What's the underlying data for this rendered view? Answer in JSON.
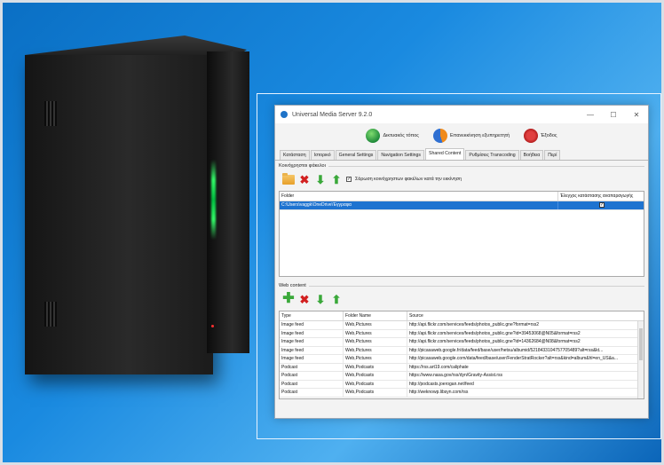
{
  "window": {
    "title": "Universal Media Server 9.2.0",
    "minimize": "—",
    "maximize": "☐",
    "close": "✕"
  },
  "toolbar": {
    "website_label": "Δικτυακός τόπος",
    "restart_label": "Επανεκκίνηση εξυπηρετητή",
    "exit_label": "Έξοδος"
  },
  "tabs": [
    {
      "label": "Κατάσταση"
    },
    {
      "label": "Ιστορικό"
    },
    {
      "label": "General Settings"
    },
    {
      "label": "Navigation Settings"
    },
    {
      "label": "Shared Content"
    },
    {
      "label": "Ρυθμίσεις Transcoding"
    },
    {
      "label": "Βοήθεια"
    },
    {
      "label": "Περί"
    }
  ],
  "shared_folders": {
    "section_title": "Κοινόχρηστοι φάκελοι",
    "scan_checkbox_label": "Σάρωση κοινόχρηστων φακέλων κατά την εκκίνηση",
    "scan_checked": "✓",
    "columns": {
      "folder": "Folder",
      "monitor": "Έλεγχος κατάστασης αναπαραγωγής"
    },
    "rows": [
      {
        "folder": "C:\\Users\\vaggk\\OneDrive\\Έγγραφα",
        "monitor": "✓"
      }
    ]
  },
  "web_content": {
    "section_title": "Web content",
    "columns": {
      "type": "Type",
      "folder_name": "Folder Name",
      "source": "Source"
    },
    "rows": [
      {
        "type": "Image feed",
        "folder": "Web,Pictures",
        "source": "http://api.flickr.com/services/feeds/photos_public.gne?format=rss2"
      },
      {
        "type": "Image feed",
        "folder": "Web,Pictures",
        "source": "http://api.flickr.com/services/feeds/photos_public.gne?id=39453068@N05&format=rss2"
      },
      {
        "type": "Image feed",
        "folder": "Web,Pictures",
        "source": "http://api.flickr.com/services/feeds/photos_public.gne?id=14362684@N08&format=rss2"
      },
      {
        "type": "Image feed",
        "folder": "Web,Pictures",
        "source": "http://picasaweb.google.fr/data/feed/base/user/hetsu/albumid/5218433104757705489?alt=rss&kt..."
      },
      {
        "type": "Image feed",
        "folder": "Web,Pictures",
        "source": "http://picasaweb.google.com/data/feed/base/user/FenderStratRocker?alt=rss&kind=album&hl=en_US&a..."
      },
      {
        "type": "Podcast",
        "folder": "Web,Podcasts",
        "source": "https://rss.art19.com/caliphate"
      },
      {
        "type": "Podcast",
        "folder": "Web,Podcasts",
        "source": "https://www.nasa.gov/rss/dyn/Gravity-Assist.rss"
      },
      {
        "type": "Podcast",
        "folder": "Web,Podcasts",
        "source": "http://podcasts.joerogan.net/feed"
      },
      {
        "type": "Podcast",
        "folder": "Web,Podcasts",
        "source": "http://weknowp.libsyn.com/rss"
      }
    ]
  }
}
